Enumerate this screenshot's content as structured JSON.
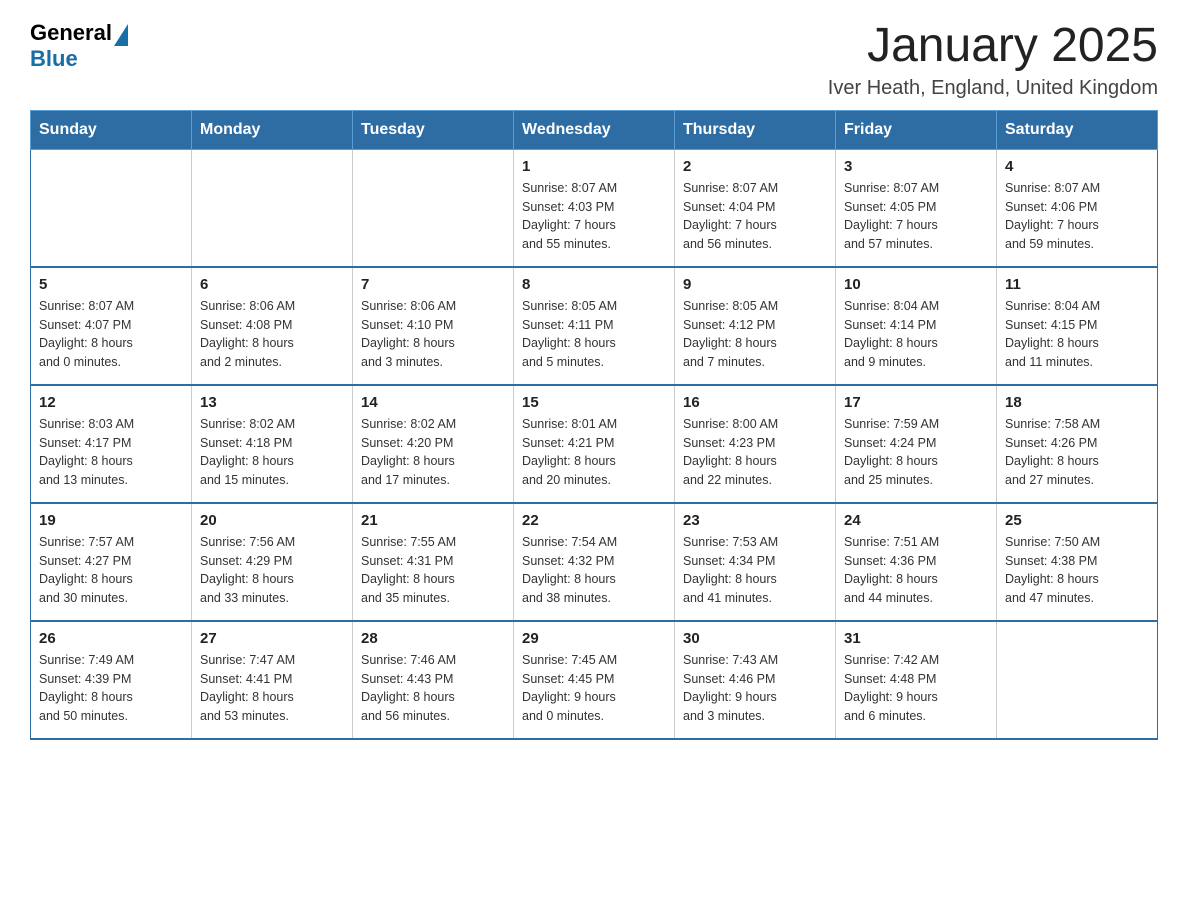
{
  "header": {
    "title": "January 2025",
    "subtitle": "Iver Heath, England, United Kingdom",
    "logo": {
      "general": "General",
      "blue": "Blue"
    }
  },
  "weekdays": [
    "Sunday",
    "Monday",
    "Tuesday",
    "Wednesday",
    "Thursday",
    "Friday",
    "Saturday"
  ],
  "weeks": [
    [
      {
        "day": "",
        "info": ""
      },
      {
        "day": "",
        "info": ""
      },
      {
        "day": "",
        "info": ""
      },
      {
        "day": "1",
        "info": "Sunrise: 8:07 AM\nSunset: 4:03 PM\nDaylight: 7 hours\nand 55 minutes."
      },
      {
        "day": "2",
        "info": "Sunrise: 8:07 AM\nSunset: 4:04 PM\nDaylight: 7 hours\nand 56 minutes."
      },
      {
        "day": "3",
        "info": "Sunrise: 8:07 AM\nSunset: 4:05 PM\nDaylight: 7 hours\nand 57 minutes."
      },
      {
        "day": "4",
        "info": "Sunrise: 8:07 AM\nSunset: 4:06 PM\nDaylight: 7 hours\nand 59 minutes."
      }
    ],
    [
      {
        "day": "5",
        "info": "Sunrise: 8:07 AM\nSunset: 4:07 PM\nDaylight: 8 hours\nand 0 minutes."
      },
      {
        "day": "6",
        "info": "Sunrise: 8:06 AM\nSunset: 4:08 PM\nDaylight: 8 hours\nand 2 minutes."
      },
      {
        "day": "7",
        "info": "Sunrise: 8:06 AM\nSunset: 4:10 PM\nDaylight: 8 hours\nand 3 minutes."
      },
      {
        "day": "8",
        "info": "Sunrise: 8:05 AM\nSunset: 4:11 PM\nDaylight: 8 hours\nand 5 minutes."
      },
      {
        "day": "9",
        "info": "Sunrise: 8:05 AM\nSunset: 4:12 PM\nDaylight: 8 hours\nand 7 minutes."
      },
      {
        "day": "10",
        "info": "Sunrise: 8:04 AM\nSunset: 4:14 PM\nDaylight: 8 hours\nand 9 minutes."
      },
      {
        "day": "11",
        "info": "Sunrise: 8:04 AM\nSunset: 4:15 PM\nDaylight: 8 hours\nand 11 minutes."
      }
    ],
    [
      {
        "day": "12",
        "info": "Sunrise: 8:03 AM\nSunset: 4:17 PM\nDaylight: 8 hours\nand 13 minutes."
      },
      {
        "day": "13",
        "info": "Sunrise: 8:02 AM\nSunset: 4:18 PM\nDaylight: 8 hours\nand 15 minutes."
      },
      {
        "day": "14",
        "info": "Sunrise: 8:02 AM\nSunset: 4:20 PM\nDaylight: 8 hours\nand 17 minutes."
      },
      {
        "day": "15",
        "info": "Sunrise: 8:01 AM\nSunset: 4:21 PM\nDaylight: 8 hours\nand 20 minutes."
      },
      {
        "day": "16",
        "info": "Sunrise: 8:00 AM\nSunset: 4:23 PM\nDaylight: 8 hours\nand 22 minutes."
      },
      {
        "day": "17",
        "info": "Sunrise: 7:59 AM\nSunset: 4:24 PM\nDaylight: 8 hours\nand 25 minutes."
      },
      {
        "day": "18",
        "info": "Sunrise: 7:58 AM\nSunset: 4:26 PM\nDaylight: 8 hours\nand 27 minutes."
      }
    ],
    [
      {
        "day": "19",
        "info": "Sunrise: 7:57 AM\nSunset: 4:27 PM\nDaylight: 8 hours\nand 30 minutes."
      },
      {
        "day": "20",
        "info": "Sunrise: 7:56 AM\nSunset: 4:29 PM\nDaylight: 8 hours\nand 33 minutes."
      },
      {
        "day": "21",
        "info": "Sunrise: 7:55 AM\nSunset: 4:31 PM\nDaylight: 8 hours\nand 35 minutes."
      },
      {
        "day": "22",
        "info": "Sunrise: 7:54 AM\nSunset: 4:32 PM\nDaylight: 8 hours\nand 38 minutes."
      },
      {
        "day": "23",
        "info": "Sunrise: 7:53 AM\nSunset: 4:34 PM\nDaylight: 8 hours\nand 41 minutes."
      },
      {
        "day": "24",
        "info": "Sunrise: 7:51 AM\nSunset: 4:36 PM\nDaylight: 8 hours\nand 44 minutes."
      },
      {
        "day": "25",
        "info": "Sunrise: 7:50 AM\nSunset: 4:38 PM\nDaylight: 8 hours\nand 47 minutes."
      }
    ],
    [
      {
        "day": "26",
        "info": "Sunrise: 7:49 AM\nSunset: 4:39 PM\nDaylight: 8 hours\nand 50 minutes."
      },
      {
        "day": "27",
        "info": "Sunrise: 7:47 AM\nSunset: 4:41 PM\nDaylight: 8 hours\nand 53 minutes."
      },
      {
        "day": "28",
        "info": "Sunrise: 7:46 AM\nSunset: 4:43 PM\nDaylight: 8 hours\nand 56 minutes."
      },
      {
        "day": "29",
        "info": "Sunrise: 7:45 AM\nSunset: 4:45 PM\nDaylight: 9 hours\nand 0 minutes."
      },
      {
        "day": "30",
        "info": "Sunrise: 7:43 AM\nSunset: 4:46 PM\nDaylight: 9 hours\nand 3 minutes."
      },
      {
        "day": "31",
        "info": "Sunrise: 7:42 AM\nSunset: 4:48 PM\nDaylight: 9 hours\nand 6 minutes."
      },
      {
        "day": "",
        "info": ""
      }
    ]
  ]
}
